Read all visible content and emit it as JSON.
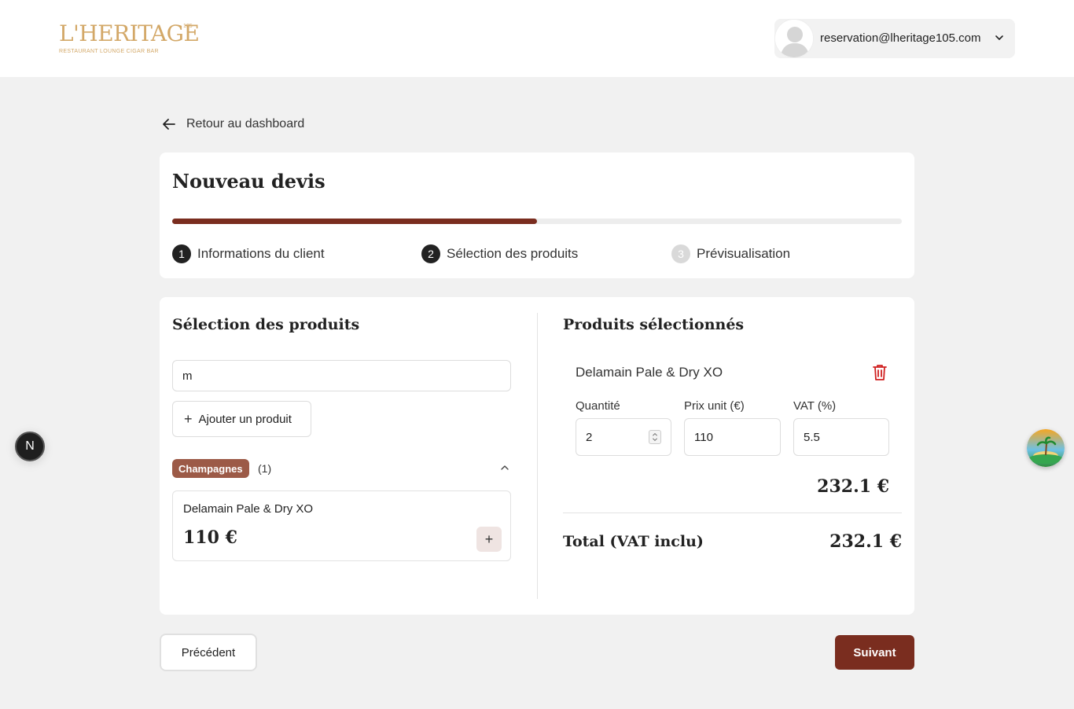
{
  "header": {
    "logo": {
      "name": "L'HERITAGE",
      "superscript": "105",
      "tagline": "RESTAURANT LOUNGE CIGAR BAR"
    },
    "user": {
      "email": "reservation@lheritage105.com",
      "avatar_icon": "user-avatar-icon",
      "menu_icon": "chevron-down-icon"
    }
  },
  "nav": {
    "back_label": "Retour au dashboard",
    "back_icon": "arrow-left-icon"
  },
  "wizard": {
    "title": "Nouveau devis",
    "progress": 0.5,
    "steps": [
      {
        "number": "1",
        "label": "Informations du client",
        "state": "done"
      },
      {
        "number": "2",
        "label": "Sélection des produits",
        "state": "current"
      },
      {
        "number": "3",
        "label": "Prévisualisation",
        "state": "pending"
      }
    ]
  },
  "products": {
    "title": "Sélection des produits",
    "search_value": "m",
    "add_label": "Ajouter un produit",
    "category": {
      "name": "Champagnes",
      "count": "(1)"
    },
    "items": [
      {
        "name": "Delamain Pale & Dry XO",
        "price": "110 €"
      }
    ]
  },
  "selected": {
    "title": "Produits sélectionnés",
    "items": [
      {
        "name": "Delamain Pale & Dry XO",
        "quantity_label": "Quantité",
        "quantity": "2",
        "price_label": "Prix unit (€)",
        "price": "110",
        "vat_label": "VAT (%)",
        "vat": "5.5",
        "subtotal": "232.1 €"
      }
    ],
    "total_label": "Total (VAT inclu)",
    "total_value": "232.1 €"
  },
  "footer": {
    "prev_label": "Précédent",
    "next_label": "Suivant"
  },
  "floating": {
    "left_badge": "N"
  },
  "colors": {
    "accent": "#7a2d1f",
    "gold": "#d3a868",
    "badge": "#9c5a47"
  }
}
